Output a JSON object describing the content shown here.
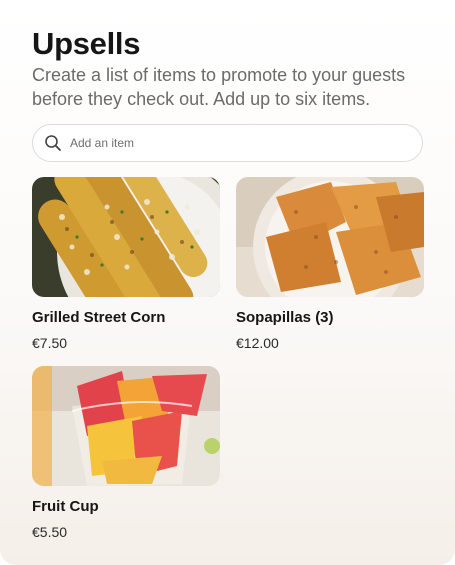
{
  "header": {
    "title": "Upsells",
    "subtitle": "Create a list of items to promote to your guests before they check out. Add up to six items."
  },
  "search": {
    "placeholder": "Add an item",
    "icon": "search-icon"
  },
  "items": [
    {
      "name": "Grilled Street Corn",
      "price": "€7.50",
      "image": "grilled-street-corn-photo"
    },
    {
      "name": "Sopapillas (3)",
      "price": "€12.00",
      "image": "sopapillas-photo"
    },
    {
      "name": "Fruit Cup",
      "price": "€5.50",
      "image": "fruit-cup-photo"
    }
  ]
}
